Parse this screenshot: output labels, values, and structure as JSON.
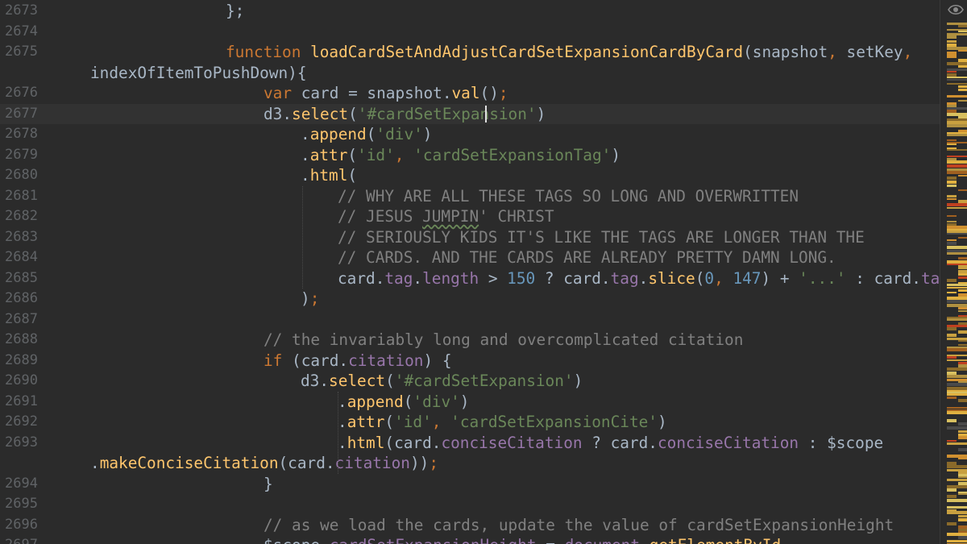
{
  "editor": {
    "current_line": "2677",
    "lines": [
      {
        "n": "2673",
        "indent": 280,
        "tokens": [
          [
            "};",
            "plain"
          ]
        ]
      },
      {
        "n": "2674",
        "indent": 280,
        "tokens": []
      },
      {
        "n": "2675",
        "indent": 280,
        "tokens": [
          [
            "function ",
            "kw"
          ],
          [
            "loadCardSetAndAdjustCardSetExpansionCardByCard",
            "fn"
          ],
          [
            "(snapshot",
            "plain"
          ],
          [
            ", ",
            "kw"
          ],
          [
            "setKey",
            "plain"
          ],
          [
            ",",
            "kw"
          ]
        ]
      },
      {
        "n": "",
        "indent": 112,
        "tokens": [
          [
            "indexOfItemToPushDown){",
            "plain"
          ]
        ]
      },
      {
        "n": "2676",
        "indent": 327,
        "tokens": [
          [
            "var ",
            "kw"
          ],
          [
            "card = snapshot.",
            "plain"
          ],
          [
            "val",
            "fn"
          ],
          [
            "()",
            "plain"
          ],
          [
            ";",
            "kw"
          ]
        ]
      },
      {
        "n": "2677",
        "indent": 327,
        "tokens": [
          [
            "d3.",
            "plain"
          ],
          [
            "select",
            "fn"
          ],
          [
            "(",
            "plain"
          ],
          [
            "'#cardSetExpansion'",
            "str"
          ],
          [
            ")",
            "plain"
          ]
        ]
      },
      {
        "n": "2678",
        "indent": 373,
        "tokens": [
          [
            ".",
            "plain"
          ],
          [
            "append",
            "fn"
          ],
          [
            "(",
            "plain"
          ],
          [
            "'div'",
            "str"
          ],
          [
            ")",
            "plain"
          ]
        ]
      },
      {
        "n": "2679",
        "indent": 373,
        "tokens": [
          [
            ".",
            "plain"
          ],
          [
            "attr",
            "fn"
          ],
          [
            "(",
            "plain"
          ],
          [
            "'id'",
            "str"
          ],
          [
            ", ",
            "kw"
          ],
          [
            "'cardSetExpansionTag'",
            "str"
          ],
          [
            ")",
            "plain"
          ]
        ]
      },
      {
        "n": "2680",
        "indent": 373,
        "tokens": [
          [
            ".",
            "plain"
          ],
          [
            "html",
            "fn"
          ],
          [
            "(",
            "plain"
          ]
        ]
      },
      {
        "n": "2681",
        "indent": 419,
        "tokens": [
          [
            "// WHY ARE ALL THESE TAGS SO LONG AND OVERWRITTEN",
            "com"
          ]
        ]
      },
      {
        "n": "2682",
        "indent": 419,
        "tokens": [
          [
            "// JESUS ",
            "com"
          ],
          [
            "JUMPIN",
            "comtypo"
          ],
          [
            "' CHRIST",
            "com"
          ]
        ]
      },
      {
        "n": "2683",
        "indent": 419,
        "tokens": [
          [
            "// SERIOUSLY KIDS IT'S LIKE THE TAGS ARE LONGER THAN THE",
            "com"
          ]
        ]
      },
      {
        "n": "2684",
        "indent": 419,
        "tokens": [
          [
            "// CARDS. AND THE CARDS ARE ALREADY PRETTY DAMN LONG.",
            "com"
          ]
        ]
      },
      {
        "n": "2685",
        "indent": 419,
        "tokens": [
          [
            "card.",
            "plain"
          ],
          [
            "tag",
            "prop"
          ],
          [
            ".",
            "plain"
          ],
          [
            "length",
            "prop"
          ],
          [
            " > ",
            "plain"
          ],
          [
            "150",
            "num"
          ],
          [
            " ? card.",
            "plain"
          ],
          [
            "tag",
            "prop"
          ],
          [
            ".",
            "plain"
          ],
          [
            "slice",
            "fn"
          ],
          [
            "(",
            "plain"
          ],
          [
            "0",
            "num"
          ],
          [
            ", ",
            "kw"
          ],
          [
            "147",
            "num"
          ],
          [
            ") + ",
            "plain"
          ],
          [
            "'...'",
            "str"
          ],
          [
            " : card.",
            "plain"
          ],
          [
            "tag",
            "prop"
          ]
        ]
      },
      {
        "n": "2686",
        "indent": 373,
        "tokens": [
          [
            ")",
            "plain"
          ],
          [
            ";",
            "kw"
          ]
        ]
      },
      {
        "n": "2687",
        "indent": 327,
        "tokens": []
      },
      {
        "n": "2688",
        "indent": 327,
        "tokens": [
          [
            "// the invariably long and overcomplicated citation",
            "com"
          ]
        ]
      },
      {
        "n": "2689",
        "indent": 327,
        "tokens": [
          [
            "if ",
            "kw"
          ],
          [
            "(card.",
            "plain"
          ],
          [
            "citation",
            "prop"
          ],
          [
            ") {",
            "plain"
          ]
        ]
      },
      {
        "n": "2690",
        "indent": 373,
        "tokens": [
          [
            "d3.",
            "plain"
          ],
          [
            "select",
            "fn"
          ],
          [
            "(",
            "plain"
          ],
          [
            "'#cardSetExpansion'",
            "str"
          ],
          [
            ")",
            "plain"
          ]
        ]
      },
      {
        "n": "2691",
        "indent": 419,
        "tokens": [
          [
            ".",
            "plain"
          ],
          [
            "append",
            "fn"
          ],
          [
            "(",
            "plain"
          ],
          [
            "'div'",
            "str"
          ],
          [
            ")",
            "plain"
          ]
        ]
      },
      {
        "n": "2692",
        "indent": 419,
        "tokens": [
          [
            ".",
            "plain"
          ],
          [
            "attr",
            "fn"
          ],
          [
            "(",
            "plain"
          ],
          [
            "'id'",
            "str"
          ],
          [
            ", ",
            "kw"
          ],
          [
            "'cardSetExpansionCite'",
            "str"
          ],
          [
            ")",
            "plain"
          ]
        ]
      },
      {
        "n": "2693",
        "indent": 419,
        "tokens": [
          [
            ".",
            "plain"
          ],
          [
            "html",
            "fn"
          ],
          [
            "(card.",
            "plain"
          ],
          [
            "conciseCitation",
            "prop"
          ],
          [
            " ? card.",
            "plain"
          ],
          [
            "conciseCitation",
            "prop"
          ],
          [
            " : $scope",
            "plain"
          ]
        ]
      },
      {
        "n": "",
        "indent": 112,
        "tokens": [
          [
            ".",
            "plain"
          ],
          [
            "makeConciseCitation",
            "fn"
          ],
          [
            "(card.",
            "plain"
          ],
          [
            "citation",
            "prop"
          ],
          [
            "))",
            "plain"
          ],
          [
            ";",
            "kw"
          ]
        ]
      },
      {
        "n": "2694",
        "indent": 327,
        "tokens": [
          [
            "}",
            "plain"
          ]
        ]
      },
      {
        "n": "2695",
        "indent": 327,
        "tokens": []
      },
      {
        "n": "2696",
        "indent": 327,
        "tokens": [
          [
            "// as we load the cards, update the value of cardSetExpansionHeight",
            "com"
          ]
        ]
      },
      {
        "n": "2697",
        "indent": 327,
        "tokens": [
          [
            "$scope.",
            "plain"
          ],
          [
            "cardSetExpansionHeight",
            "prop"
          ],
          [
            " = ",
            "plain"
          ],
          [
            "document",
            "prop"
          ],
          [
            ".",
            "plain"
          ],
          [
            "getElementById",
            "fn"
          ]
        ]
      }
    ]
  },
  "colors": {
    "background": "#2b2b2b",
    "current_line": "#323232",
    "line_number": "#606366",
    "plain": "#a9b7c6",
    "keyword": "#cc7832",
    "function": "#ffc66d",
    "string": "#6a8759",
    "number": "#6897bb",
    "comment": "#808080",
    "property": "#9876aa"
  },
  "icons": {
    "top_right": "eye-icon"
  }
}
